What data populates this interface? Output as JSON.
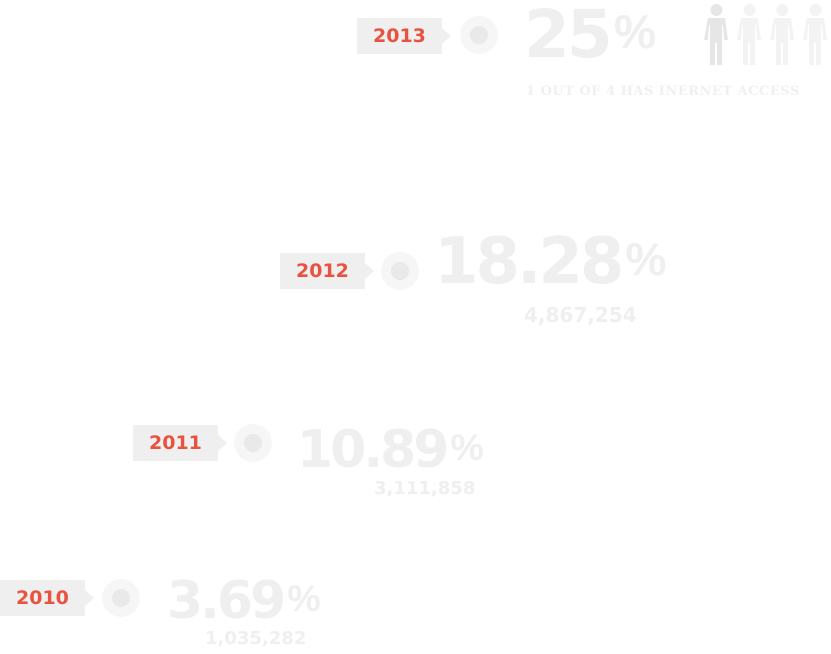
{
  "timeline": [
    {
      "year": "2013",
      "percent": "25",
      "percent_sign": "%",
      "detail": "1 OUT OF 4 HAS INERNET ACCESS",
      "people_icons": [
        "person-filled-icon",
        "person-faded-icon",
        "person-faded-icon",
        "person-faded-icon"
      ]
    },
    {
      "year": "2012",
      "percent": "18.28",
      "percent_sign": "%",
      "detail": "4,867,254"
    },
    {
      "year": "2011",
      "percent": "10.89",
      "percent_sign": "%",
      "detail": "3,111,858"
    },
    {
      "year": "2010",
      "percent": "3.69",
      "percent_sign": "%",
      "detail": "1,035,282"
    }
  ],
  "colors": {
    "year_text": "#e8523f",
    "year_tag_bg": "#efefef",
    "value_text": "#efefef",
    "dot_outer": "#f6f6f6",
    "dot_inner": "#e9e9e9"
  }
}
